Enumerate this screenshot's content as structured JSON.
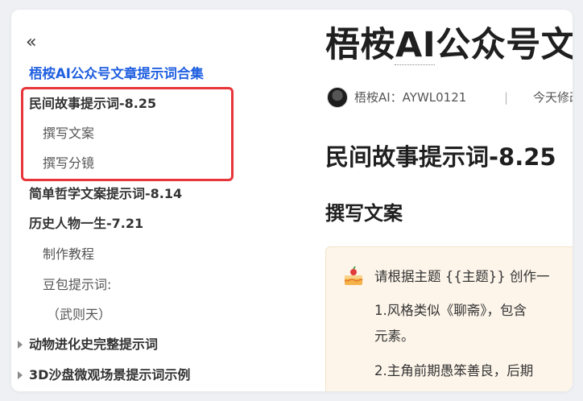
{
  "sidebar": {
    "collapse_glyph": "«",
    "items": [
      {
        "label": "梧桉AI公众号文章提示词合集",
        "level": "root"
      },
      {
        "label": "民间故事提示词-8.25",
        "level": "h1"
      },
      {
        "label": "撰写文案",
        "level": "h2"
      },
      {
        "label": "撰写分镜",
        "level": "h2"
      },
      {
        "label": "简单哲学文案提示词-8.14",
        "level": "h1"
      },
      {
        "label": "历史人物一生-7.21",
        "level": "h1"
      },
      {
        "label": "制作教程",
        "level": "h2"
      },
      {
        "label": "豆包提示词:",
        "level": "h2"
      },
      {
        "label": "（武则天）",
        "level": "h3"
      },
      {
        "label": "动物进化史完整提示词",
        "level": "h1",
        "collapsed": true
      },
      {
        "label": "3D沙盘微观场景提示词示例",
        "level": "h1",
        "collapsed": true
      }
    ]
  },
  "main": {
    "title": "梧桉AI公众号文",
    "author": "梧桉AI：AYWL0121",
    "separator": "|",
    "modified": "今天修改",
    "h1": "民间故事提示词-8.25",
    "h2": "撰写文案",
    "callout": {
      "icon": "cake-icon",
      "lines": [
        "请根据主题 {{主题}} 创作一",
        "1.风格类似《聊斋》，包含",
        "元素。",
        "2.主角前期愚笨善良，后期"
      ]
    }
  },
  "colors": {
    "accent": "#1f5fe0",
    "highlight": "#e8353a",
    "callout_bg": "#fdf5ea"
  }
}
